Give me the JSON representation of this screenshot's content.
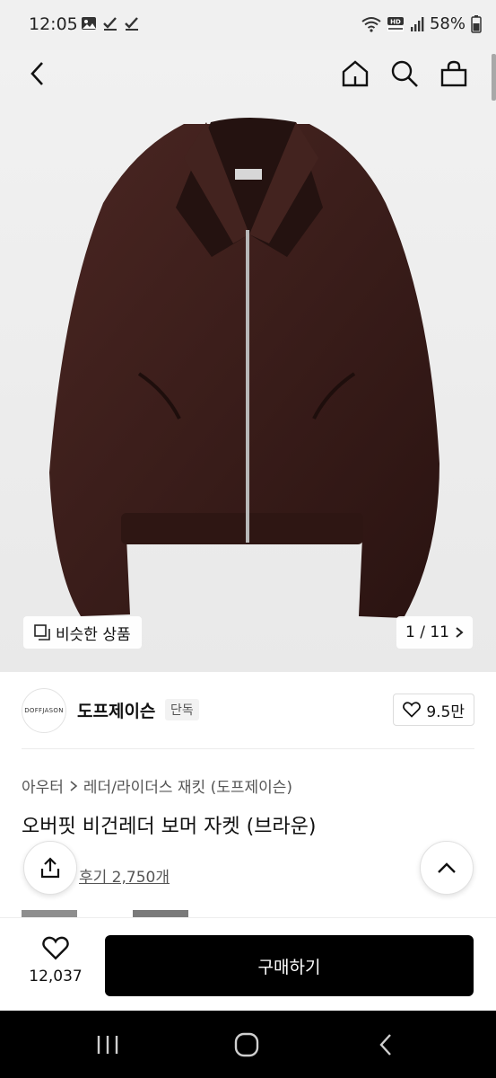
{
  "status_bar": {
    "time": "12:05",
    "battery": "58%",
    "icons": [
      "gallery-icon",
      "check-icon",
      "check-icon",
      "wifi-icon",
      "hd-voice-icon",
      "signal-icon",
      "battery-icon"
    ]
  },
  "header": {
    "icons": [
      "back-icon",
      "home-icon",
      "search-icon",
      "cart-icon"
    ]
  },
  "image": {
    "similar_label": "비슷한 상품",
    "counter": "1 / 11",
    "jacket_color": "#3a1f1c"
  },
  "brand": {
    "logo_text": "DOFFJASON",
    "name": "도프제이슨",
    "badge": "단독",
    "like_count": "9.5만"
  },
  "breadcrumb": {
    "category": "아우터",
    "subcategory": "레더/라이더스 재킷 (도프제이슨)"
  },
  "product": {
    "title": "오버핏 비건레더 보머 자켓 (브라운)",
    "reviews": "후기 2,750개"
  },
  "bottom": {
    "like_count": "12,037",
    "buy_label": "구매하기"
  },
  "colors": {
    "accent": "#000000",
    "image_bg": "#eeeeee"
  }
}
